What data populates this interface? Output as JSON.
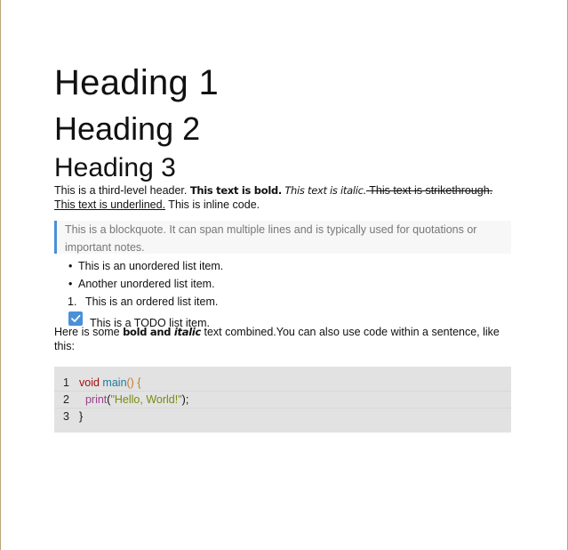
{
  "headings": {
    "h1": "Heading 1",
    "h2": "Heading 2",
    "h3": "Heading 3"
  },
  "paragraph": {
    "plain1": "This is a third-level header. ",
    "bold": "This text is bold.",
    "italic": " This text is italic.",
    "strike": " This text is strikethrough.",
    "underline": "This text is underlined.",
    "plain2": " This is inline code."
  },
  "blockquote": "This is a blockquote. It can span multiple lines and is typically used for quotations or important notes.",
  "unordered_list": [
    "This is an unordered list item.",
    "Another unordered list item."
  ],
  "ordered_list": [
    {
      "num": "1.",
      "text": "This is an ordered list item."
    }
  ],
  "todo": {
    "text": "This is a TODO list item.",
    "checked": true
  },
  "combined": {
    "plain1": "Here is some ",
    "bold": "bold and ",
    "bold_italic": "italic",
    "plain2": " text combined.You can also use code within a sentence, like this:"
  },
  "code": {
    "lines": [
      {
        "num": "1",
        "kw": "void",
        "fn": "main",
        "rest": "() {"
      },
      {
        "num": "2",
        "call": "print",
        "open": "(",
        "str": "\"Hello, World!\"",
        "close": ");"
      },
      {
        "num": "3",
        "text": "}"
      }
    ]
  },
  "colors": {
    "accent": "#4a90d9",
    "code_background": "#e2e2e2",
    "blockquote_background": "#f7f7f7"
  }
}
